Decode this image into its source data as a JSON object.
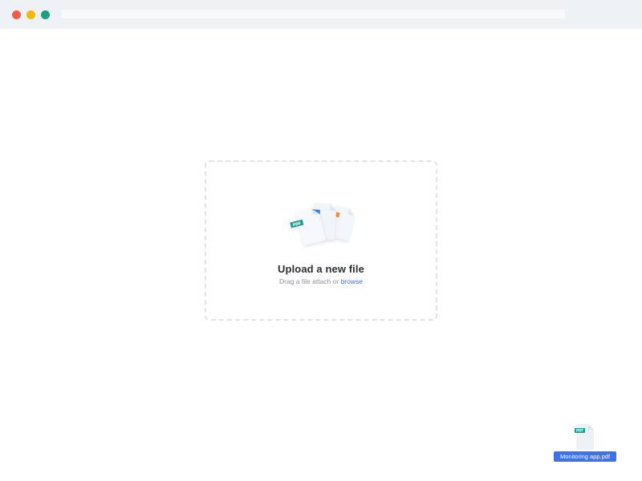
{
  "window": {
    "controls": [
      "close",
      "minimize",
      "maximize"
    ],
    "colors": {
      "close": "#f15b4a",
      "minimize": "#f5b800",
      "maximize": "#16a086"
    }
  },
  "upload": {
    "title": "Upload a new file",
    "subtitle_prefix": "Drag a file attach or ",
    "browse_label": "browse",
    "file_badges": [
      "PDF",
      "DOC",
      "XLS"
    ],
    "accent_color": "#3a6ee0"
  },
  "dragged_file": {
    "badge": "PDF",
    "name": "Monitoring app.pdf",
    "label_bg": "#3e73e8"
  }
}
